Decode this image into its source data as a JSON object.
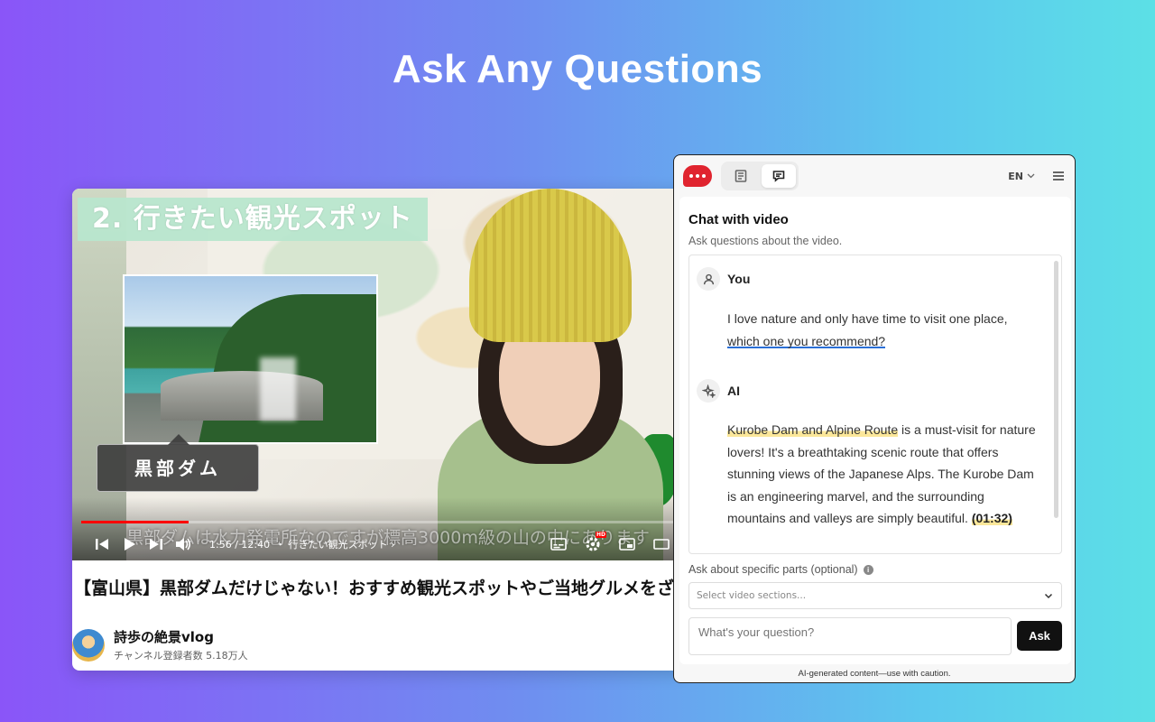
{
  "hero": {
    "title": "Ask Any Questions"
  },
  "video": {
    "caption_tag": "2. 行きたい観光スポット",
    "place_tag": "黒部ダム",
    "subtitle": "黒部ダムは水力発電所なのですが標高3000m級の山の中にあります",
    "time": "1:56 / 12:40",
    "chapter": "・ 行きたい観光スポット ›",
    "progress_fraction": 0.18,
    "title": "【富山県】黒部ダムだけじゃない！おすすめ観光スポットやご当地グルメをざ",
    "channel_name": "詩歩の絶景vlog",
    "channel_subs": "チャンネル登録者数 5.18万人",
    "hd_label": "HD"
  },
  "panel": {
    "lang": "EN",
    "chat_title": "Chat with video",
    "chat_subtitle": "Ask questions about the video.",
    "user_role": "You",
    "user_message_part1": "I love nature and only have time to visit one place, ",
    "user_message_part2": "which one you recommend?",
    "ai_role": "AI",
    "ai_highlight": "Kurobe Dam and Alpine Route",
    "ai_message": " is a must-visit for nature lovers! It's a breathtaking scenic route that offers stunning views of the Japanese Alps. The Kurobe Dam is an engineering marvel, and the surrounding mountains and valleys are simply beautiful. ",
    "ai_timestamp": "(01:32)",
    "section_label": "Ask about specific parts (optional)",
    "section_placeholder": "Select video sections...",
    "question_placeholder": "What's your question?",
    "ask_label": "Ask",
    "disclaimer": "AI-generated content—use with caution."
  },
  "colors": {
    "accent_red": "#e0242f",
    "underline_blue": "#2a6fd6",
    "highlight_yellow": "#fbe79a"
  }
}
